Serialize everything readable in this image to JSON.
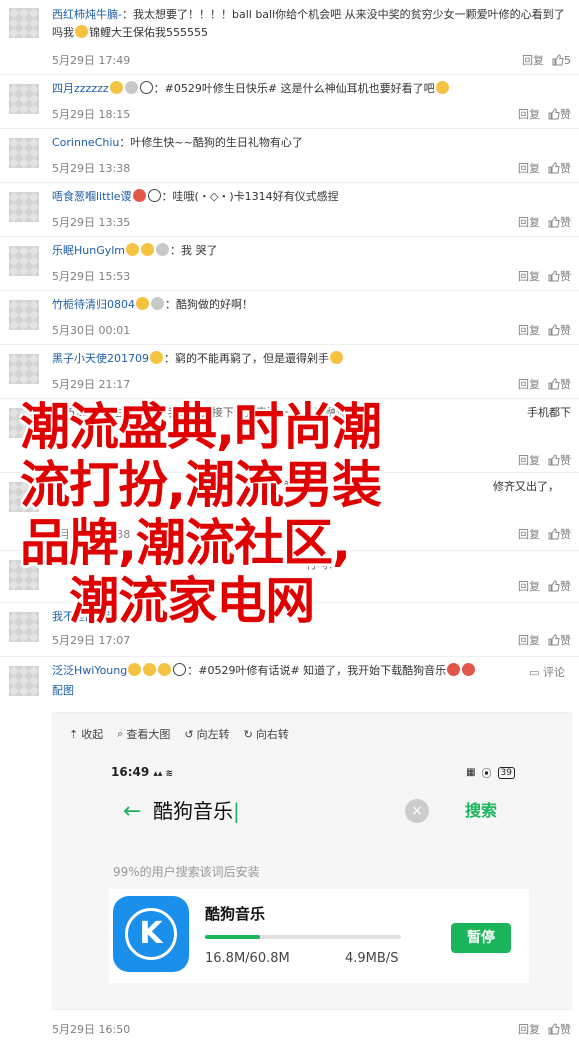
{
  "actions": {
    "reply": "回复",
    "comment": "评论",
    "like": "赞"
  },
  "comments": [
    {
      "name": "西红柿炖牛腩-",
      "text": "：我太想要了！！！！ball  ball你给个机会吧 从来没中奖的贫穷少女一颗爱叶修的心看到了吗我",
      "text2": "锦鲤大王保佑我555555",
      "time": "5月29日 17:49"
    },
    {
      "name": "四月zzzzzz",
      "text": "：#0529叶修生日快乐# 这是什么神仙耳机也要好看了吧",
      "time": "5月29日 18:15"
    },
    {
      "name": "CorinneChiu",
      "text": "：叶修生快~~酷狗的生日礼物有心了",
      "time": "5月29日 13:38"
    },
    {
      "name": "唔食葱嗰little谡",
      "text": "：哇哦(・◇・)卡1314好有仪式感捏",
      "time": "5月29日 13:35"
    },
    {
      "name": "乐眠HunGylm",
      "text": "：我     哭了",
      "time": "5月29日 15:53"
    },
    {
      "name": "竹栀待清归0804",
      "text": "：酷狗做的好啊！",
      "time": "5月30日 00:01"
    },
    {
      "name": "黑子小天使201709",
      "text": "：窮的不能再窮了，但是還得剁手",
      "time": "5月29日 21:17"
    },
    {
      "name": "",
      "text": "#0529叶修生日快乐# 我选了直接下载直表演一下... 速融速乐",
      "text_tail": "手机都下",
      "time": ""
    },
    {
      "name": "",
      "text": "帅啊，希望...",
      "text_tail": "修齐又出了，",
      "time": "5月29日 13:38"
    },
    {
      "name": "",
      "text": "...",
      "text_tail": "行吗？",
      "time": ""
    },
    {
      "name": "我不是回-贷",
      "text": "：...天天...",
      "time": "5月29日 17:07"
    },
    {
      "name": "泛泛HwiYoung",
      "text": "：#0529叶修有话说# 知道了，我开始下载酷狗音乐",
      "text2": "配图",
      "time": "5月29日 16:50"
    }
  ],
  "overlay": {
    "lines": [
      "潮流盛典,时尚潮",
      "流打扮,潮流男装",
      "品牌,潮流社区,",
      "   潮流家电网"
    ]
  },
  "embed": {
    "toolbar": [
      "收起",
      "查看大图",
      "向左转",
      "向右转"
    ],
    "status_time": "16:49",
    "battery": "39",
    "search_text": "酷狗音乐",
    "search_btn": "搜索",
    "hint": "99%的用户搜索该词后安装",
    "app_name": "酷狗音乐",
    "progress": 0.28,
    "size": "16.8M/60.8M",
    "speed": "4.9MB/S",
    "pause": "暂停",
    "logo_letter": "K"
  }
}
